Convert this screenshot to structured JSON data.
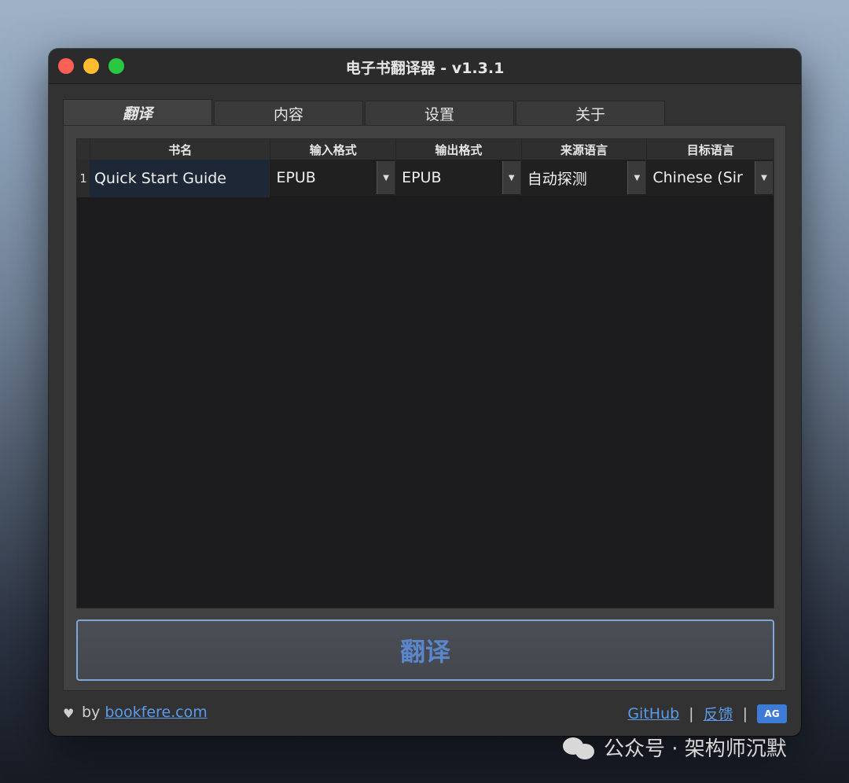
{
  "window": {
    "title": "电子书翻译器 - v1.3.1"
  },
  "tabs": [
    {
      "label": "翻译",
      "active": true
    },
    {
      "label": "内容",
      "active": false
    },
    {
      "label": "设置",
      "active": false
    },
    {
      "label": "关于",
      "active": false
    }
  ],
  "table": {
    "headers": {
      "name": "书名",
      "input_format": "输入格式",
      "output_format": "输出格式",
      "source_lang": "来源语言",
      "target_lang": "目标语言"
    },
    "rows": [
      {
        "index": "1",
        "name": "Quick Start Guide",
        "input_format": "EPUB",
        "output_format": "EPUB",
        "source_lang": "自动探测",
        "target_lang": "Chinese (Sir"
      }
    ]
  },
  "actions": {
    "translate_label": "翻译"
  },
  "footer": {
    "by_label": "by",
    "site_link": "bookfere.com",
    "github_link": "GitHub",
    "feedback_link": "反馈",
    "separator": "|",
    "lang_icon_text": "AG"
  },
  "watermark": {
    "text": "公众号 · 架构师沉默"
  },
  "colors": {
    "accent": "#5b9bea",
    "button_border": "#7fa7d6",
    "button_text": "#5a86cc"
  },
  "icons": {
    "heart": "heart-icon",
    "dropdown": "chevron-down-icon",
    "translate": "translate-icon",
    "wechat": "wechat-icon"
  }
}
